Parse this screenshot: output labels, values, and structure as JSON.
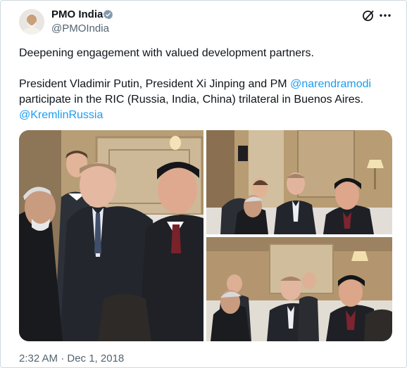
{
  "post": {
    "author_name": "PMO India",
    "author_handle": "@PMOIndia",
    "verified": true,
    "line1": "Deepening engagement with valued development partners.",
    "line2_a": "President Vladimir Putin, President Xi Jinping and PM ",
    "mention1": "@narendramodi",
    "line2_b": " participate in the RIC (Russia, India, China) trilateral in Buenos Aires.",
    "mention2": "@KremlinRussia",
    "timestamp": "2:32 AM · Dec 1, 2018"
  },
  "icons": {
    "verified": "verified-badge-icon",
    "grok": "grok-icon",
    "more": "more-icon"
  },
  "colors": {
    "link": "#1d9bf0",
    "secondary_text": "#536471",
    "border": "#cfd9de"
  }
}
